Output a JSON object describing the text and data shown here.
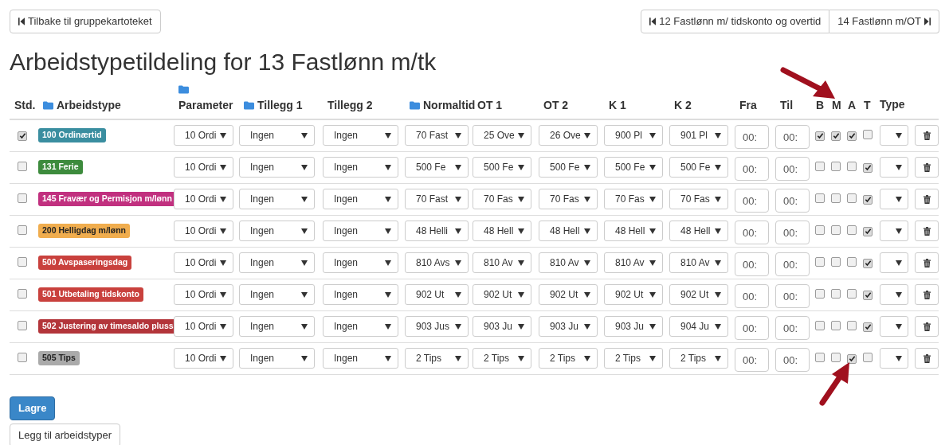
{
  "back_button": "Tilbake til gruppekartoteket",
  "nav_buttons": [
    {
      "label": "12 Fastlønn m/ tidskonto og overtid",
      "kind": "prev"
    },
    {
      "label": "14 Fastlønn m/OT",
      "kind": "next"
    }
  ],
  "title": "Arbeidstypetildeling for 13 Fastlønn m/tk",
  "table": {
    "columns": [
      {
        "label": "Std.",
        "folder": false
      },
      {
        "label": "Arbeidstype",
        "folder": true
      },
      {
        "label": "Parameter",
        "folder": true
      },
      {
        "label": "Tillegg 1",
        "folder": true
      },
      {
        "label": "Tillegg 2",
        "folder": false
      },
      {
        "label": "Normaltid",
        "folder": true
      },
      {
        "label": "OT 1",
        "folder": false
      },
      {
        "label": "OT 2",
        "folder": false
      },
      {
        "label": "K 1",
        "folder": false
      },
      {
        "label": "K 2",
        "folder": false
      },
      {
        "label": "Fra",
        "folder": false
      },
      {
        "label": "Til",
        "folder": false
      },
      {
        "label": "B",
        "folder": false
      },
      {
        "label": "M",
        "folder": false
      },
      {
        "label": "A",
        "folder": false
      },
      {
        "label": "T",
        "folder": false
      },
      {
        "label": "Type",
        "folder": false
      }
    ],
    "rows": [
      {
        "std": true,
        "label": "100 Ordinærtid",
        "color": "#3a8ea0",
        "selects": [
          "10 Ordi",
          "Ingen",
          "Ingen",
          "70 Fast",
          "25 Ove",
          "26 Ove",
          "900 Pl",
          "901 Pl"
        ],
        "fra": "00:",
        "til": "00:",
        "flags": [
          true,
          true,
          true,
          false
        ]
      },
      {
        "std": false,
        "label": "131 Ferie",
        "color": "#3d8b3d",
        "selects": [
          "10 Ordi",
          "Ingen",
          "Ingen",
          "500 Fe",
          "500 Fe",
          "500 Fe",
          "500 Fe",
          "500 Fe"
        ],
        "fra": "00:",
        "til": "00:",
        "flags": [
          false,
          false,
          false,
          true
        ]
      },
      {
        "std": false,
        "label": "145 Fravær og Permisjon m/lønn",
        "color": "#c1307f",
        "selects": [
          "10 Ordi",
          "Ingen",
          "Ingen",
          "70 Fast",
          "70 Fas",
          "70 Fas",
          "70 Fas",
          "70 Fas"
        ],
        "fra": "00:",
        "til": "00:",
        "flags": [
          false,
          false,
          false,
          true
        ]
      },
      {
        "std": false,
        "label": "200 Helligdag m/lønn",
        "color": "#f0ad4e",
        "selects": [
          "10 Ordi",
          "Ingen",
          "Ingen",
          "48 Helli",
          "48 Hell",
          "48 Hell",
          "48 Hell",
          "48 Hell"
        ],
        "fra": "00:",
        "til": "00:",
        "flags": [
          false,
          false,
          false,
          true
        ]
      },
      {
        "std": false,
        "label": "500 Avspaseringsdag",
        "color": "#c9413d",
        "selects": [
          "10 Ordi",
          "Ingen",
          "Ingen",
          "810 Avs",
          "810 Av",
          "810 Av",
          "810 Av",
          "810 Av"
        ],
        "fra": "00:",
        "til": "00:",
        "flags": [
          false,
          false,
          false,
          true
        ]
      },
      {
        "std": false,
        "label": "501 Utbetaling tidskonto",
        "color": "#c9413d",
        "selects": [
          "10 Ordi",
          "Ingen",
          "Ingen",
          "902 Ut",
          "902 Ut",
          "902 Ut",
          "902 Ut",
          "902 Ut"
        ],
        "fra": "00:",
        "til": "00:",
        "flags": [
          false,
          false,
          false,
          true
        ]
      },
      {
        "std": false,
        "label": "502 Justering av timesaldo pluss",
        "color": "#b3353a",
        "selects": [
          "10 Ordi",
          "Ingen",
          "Ingen",
          "903 Jus",
          "903 Ju",
          "903 Ju",
          "903 Ju",
          "904 Ju"
        ],
        "fra": "00:",
        "til": "00:",
        "flags": [
          false,
          false,
          false,
          true
        ]
      },
      {
        "std": false,
        "label": "505 Tips",
        "color": "#aaaaaa",
        "selects": [
          "10 Ordi",
          "Ingen",
          "Ingen",
          "2 Tips",
          "2 Tips",
          "2 Tips",
          "2 Tips",
          "2 Tips"
        ],
        "fra": "00:",
        "til": "00:",
        "flags": [
          false,
          false,
          true,
          false
        ]
      }
    ]
  },
  "save_button": "Lagre",
  "add_button": "Legg til arbeidstyper"
}
